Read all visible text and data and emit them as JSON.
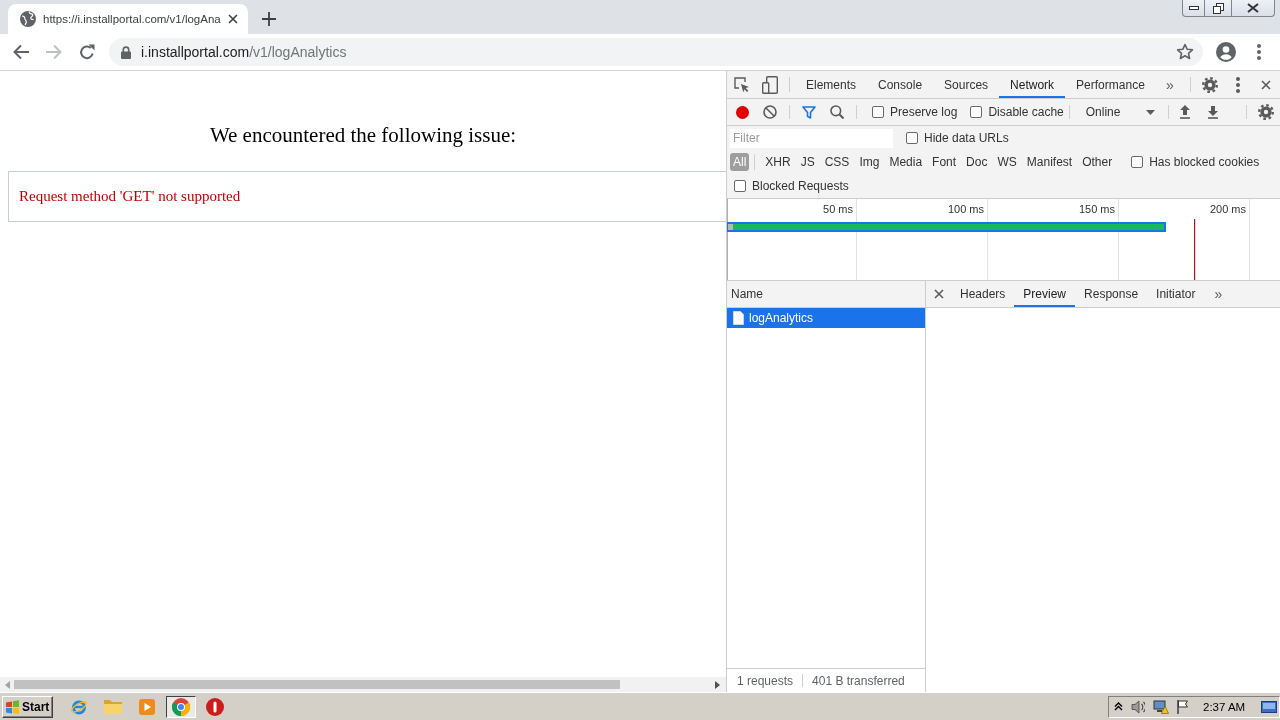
{
  "browser": {
    "tabs": [
      {
        "title": "https://i.installportal.com/v1/logAna",
        "selected": true
      }
    ],
    "back": {
      "disabled": false
    },
    "forward": {
      "disabled": true
    },
    "address": {
      "host": "i.installportal.com",
      "path": "/v1/logAnalytics"
    }
  },
  "page": {
    "heading": "We encountered the following issue:",
    "error": "Request method 'GET' not supported"
  },
  "devtools": {
    "tabs": [
      {
        "label": "Elements",
        "selected": false
      },
      {
        "label": "Console",
        "selected": false
      },
      {
        "label": "Sources",
        "selected": false
      },
      {
        "label": "Network",
        "selected": true
      },
      {
        "label": "Performance",
        "selected": false
      }
    ],
    "tabs_more": "»",
    "recording": true,
    "options": [
      {
        "label": "Preserve log",
        "checked": false
      },
      {
        "label": "Disable cache",
        "checked": false
      }
    ],
    "throttling": "Online",
    "filter": {
      "placeholder": "Filter"
    },
    "hide_data_urls": {
      "label": "Hide data URLs",
      "checked": false
    },
    "types": [
      {
        "label": "All",
        "selected": true
      },
      {
        "label": "XHR",
        "selected": false
      },
      {
        "label": "JS",
        "selected": false
      },
      {
        "label": "CSS",
        "selected": false
      },
      {
        "label": "Img",
        "selected": false
      },
      {
        "label": "Media",
        "selected": false
      },
      {
        "label": "Font",
        "selected": false
      },
      {
        "label": "Doc",
        "selected": false
      },
      {
        "label": "WS",
        "selected": false
      },
      {
        "label": "Manifest",
        "selected": false
      },
      {
        "label": "Other",
        "selected": false
      }
    ],
    "has_blocked_cookies": {
      "label": "Has blocked cookies",
      "checked": false
    },
    "blocked_requests": {
      "label": "Blocked Requests",
      "checked": false
    },
    "overview": {
      "ticks": [
        "50 ms",
        "100 ms",
        "150 ms",
        "200 ms"
      ]
    },
    "requests": {
      "column": "Name",
      "rows": [
        {
          "name": "logAnalytics",
          "selected": true
        }
      ],
      "status": [
        "1 requests",
        "401 B transferred"
      ]
    },
    "detail_tabs": [
      {
        "label": "Headers",
        "selected": false
      },
      {
        "label": "Preview",
        "selected": true
      },
      {
        "label": "Response",
        "selected": false
      },
      {
        "label": "Initiator",
        "selected": false
      }
    ],
    "detail_more": "»"
  },
  "taskbar": {
    "start": "Start",
    "apps": [
      {
        "kind": "e",
        "active": false
      },
      {
        "kind": "folder",
        "active": false
      },
      {
        "kind": "player",
        "active": false
      },
      {
        "kind": "browser",
        "active": true
      },
      {
        "kind": "circle",
        "active": false
      }
    ],
    "clock": "2:37 AM"
  }
}
